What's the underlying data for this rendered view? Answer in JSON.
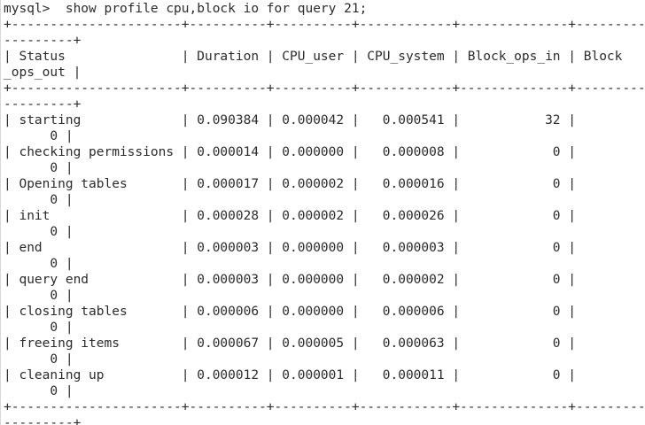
{
  "terminal": {
    "lines": [
      "mysql>  show profile cpu,block io for query 21;",
      "+----------------------+----------+----------+------------+--------------+------------",
      "---------+",
      "| Status               | Duration | CPU_user | CPU_system | Block_ops_in | Block",
      "_ops_out |",
      "+----------------------+----------+----------+------------+--------------+------------",
      "---------+",
      "| starting             | 0.090384 | 0.000042 |   0.000541 |           32 |",
      "      0 |",
      "| checking permissions | 0.000014 | 0.000000 |   0.000008 |            0 |",
      "      0 |",
      "| Opening tables       | 0.000017 | 0.000002 |   0.000016 |            0 |",
      "      0 |",
      "| init                 | 0.000028 | 0.000002 |   0.000026 |            0 |",
      "      0 |",
      "| end                  | 0.000003 | 0.000000 |   0.000003 |            0 |",
      "      0 |",
      "| query end            | 0.000003 | 0.000000 |   0.000002 |            0 |",
      "      0 |",
      "| closing tables       | 0.000006 | 0.000000 |   0.000006 |            0 |",
      "      0 |",
      "| freeing items        | 0.000067 | 0.000005 |   0.000063 |            0 |",
      "      0 |",
      "| cleaning up          | 0.000012 | 0.000001 |   0.000011 |            0 |",
      "      0 |",
      "+----------------------+----------+----------+------------+--------------+------------",
      "---------+"
    ]
  }
}
